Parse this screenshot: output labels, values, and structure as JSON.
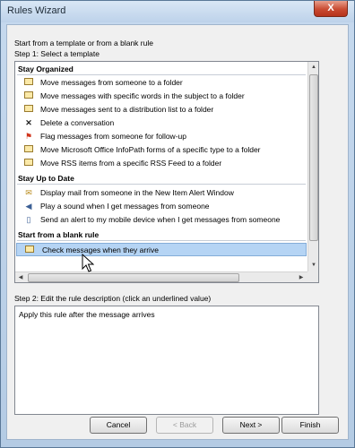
{
  "window": {
    "title": "Rules Wizard",
    "close_label": "X"
  },
  "intro": {
    "line1": "Start from a template or from a blank rule",
    "step1": "Step 1: Select a template"
  },
  "sections": [
    {
      "header": "Stay Organized",
      "items": [
        {
          "label": "Move messages from someone to a folder",
          "icon": "envelope-folder-icon"
        },
        {
          "label": "Move messages with specific words in the subject to a folder",
          "icon": "envelope-folder-icon"
        },
        {
          "label": "Move messages sent to a distribution list to a folder",
          "icon": "envelope-folder-icon"
        },
        {
          "label": "Delete a conversation",
          "icon": "delete-x-icon"
        },
        {
          "label": "Flag messages from someone for follow-up",
          "icon": "flag-icon"
        },
        {
          "label": "Move Microsoft Office InfoPath forms of a specific type to a folder",
          "icon": "envelope-folder-icon"
        },
        {
          "label": "Move RSS items from a specific RSS Feed to a folder",
          "icon": "envelope-folder-icon"
        }
      ]
    },
    {
      "header": "Stay Up to Date",
      "items": [
        {
          "label": "Display mail from someone in the New Item Alert Window",
          "icon": "alert-window-icon"
        },
        {
          "label": "Play a sound when I get messages from someone",
          "icon": "speaker-icon"
        },
        {
          "label": "Send an alert to my mobile device when I get messages from someone",
          "icon": "mobile-device-icon"
        }
      ]
    },
    {
      "header": "Start from a blank rule",
      "items": [
        {
          "label": "Check messages when they arrive",
          "icon": "envelope-icon",
          "selected": true
        }
      ]
    }
  ],
  "step2": {
    "label": "Step 2: Edit the rule description (click an underlined value)",
    "description": "Apply this rule after the message arrives"
  },
  "buttons": {
    "cancel": "Cancel",
    "back": "< Back",
    "next": "Next >",
    "finish": "Finish"
  },
  "colors": {
    "selection": "#b5d4f4",
    "close_button": "#c94b32",
    "window_frame": "#b4cbe4"
  }
}
